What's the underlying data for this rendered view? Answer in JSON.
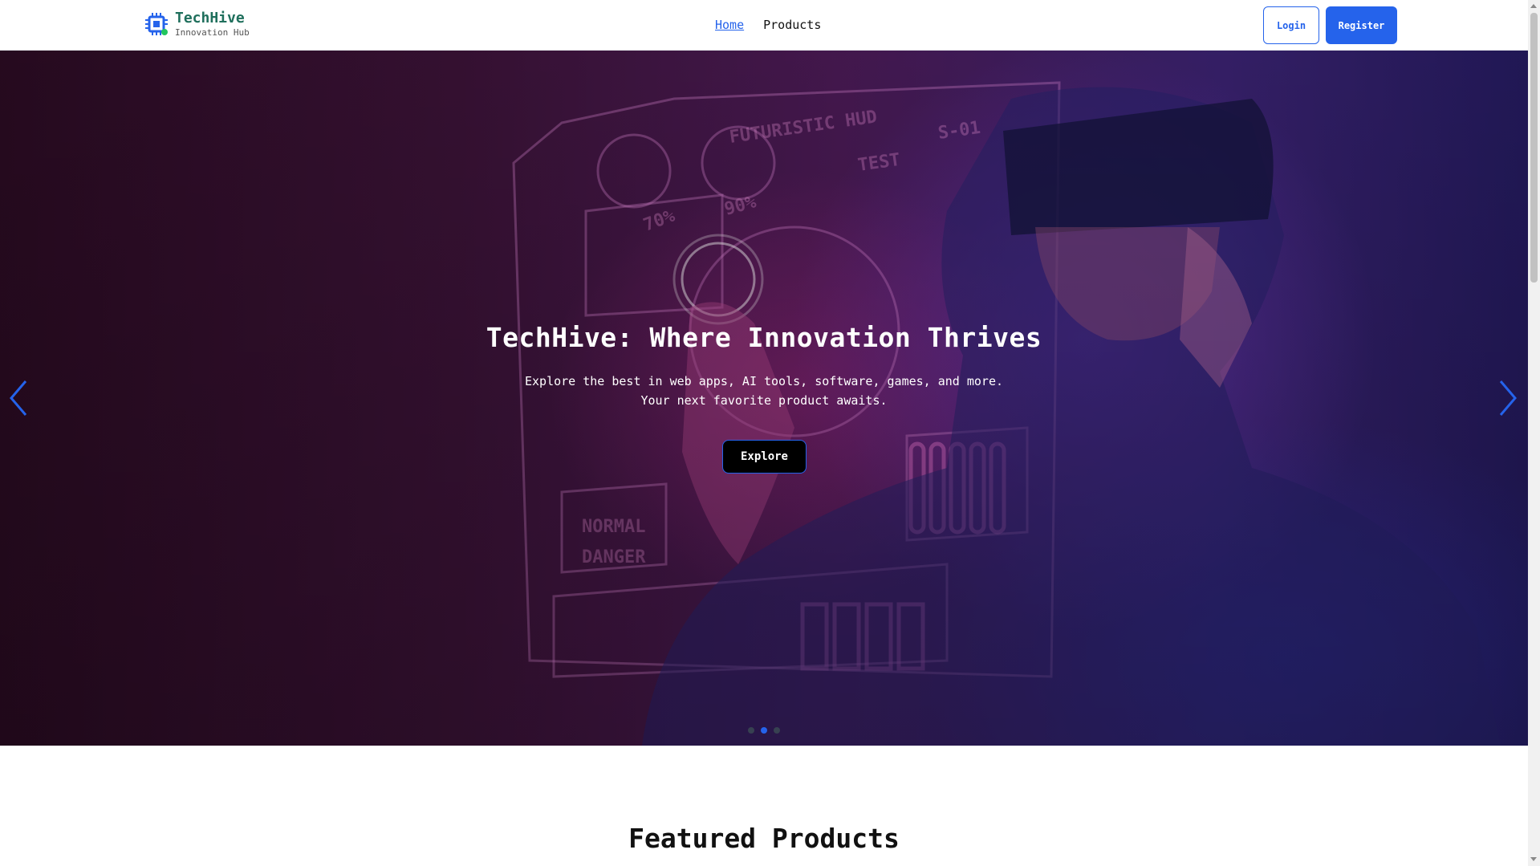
{
  "brand": {
    "name": "TechHive",
    "tagline": "Innovation Hub",
    "icon": "chip-icon",
    "color": "#1f6f5c"
  },
  "nav": {
    "links": [
      {
        "label": "Home",
        "active": true
      },
      {
        "label": "Products",
        "active": false
      }
    ]
  },
  "auth": {
    "login_label": "Login",
    "register_label": "Register",
    "accent": "#2563eb"
  },
  "hero": {
    "title": "TechHive: Where Innovation Thrives",
    "subtitle_line1": "Explore the best in web apps, AI tools, software, games, and more.",
    "subtitle_line2": "Your next favorite product awaits.",
    "cta_label": "Explore",
    "background_image": "person wearing VR headset with futuristic HUD",
    "hud_labels": [
      "FUTURISTIC HUD",
      "TEST",
      "S-01",
      "70%",
      "90%",
      "NORMAL",
      "DANGER"
    ],
    "carousel": {
      "slide_count": 3,
      "active_index": 1,
      "prev_icon": "chevron-left-icon",
      "next_icon": "chevron-right-icon"
    }
  },
  "featured": {
    "title": "Featured Products"
  }
}
